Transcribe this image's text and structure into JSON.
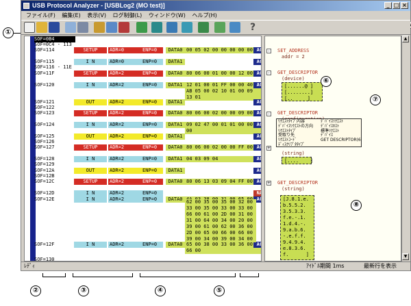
{
  "window": {
    "title": "USB Protocol Analyzer - [USBLog2 (MO test)]"
  },
  "menu": [
    "ファイル(F)",
    "編集(E)",
    "表示(V)",
    "ログ制御(L)",
    "ウィンドウ(W)",
    "ヘルプ(H)"
  ],
  "toolbar_icons": [
    "new-icon",
    "open-icon",
    "save-icon",
    "copy-icon",
    "cut-icon",
    "undo-icon",
    "paste-icon",
    "redo-icon",
    "edit-icon",
    "capture-icon",
    "filter-icon",
    "export-icon",
    "settings-icon",
    "tools-icon",
    "grid-icon",
    "help-icon"
  ],
  "trace": [
    {
      "sof": "SOF=0B4",
      "kind": "sof-dark"
    },
    {
      "sof": "SOF=0C4  - 113",
      "kind": "sof"
    },
    {
      "sof": "SOF=114",
      "token": "SETUP",
      "adr": "ADR=0",
      "enp": "ENP=0",
      "pid": "DATA0",
      "data": "00 05 02 00 00 00 00 00",
      "hs": "ACK"
    },
    {
      "sof": "SOF=115",
      "token": "I N",
      "adr": "ADR=0",
      "enp": "ENP=0",
      "pid": "DATA1",
      "data": "",
      "hs": "ACK"
    },
    {
      "sof": "SOF=116  - 11E",
      "kind": "sof"
    },
    {
      "sof": "SOF=11F",
      "token": "SETUP",
      "adr": "ADR=2",
      "enp": "ENP=0",
      "pid": "DATA0",
      "data": "80 06 00 01 00 00 12 00",
      "hs": "ACK"
    },
    {
      "sof": "SOF=120",
      "token": "I N",
      "adr": "ADR=2",
      "enp": "ENP=0",
      "pid": "DATA1",
      "data": "12 01 00 01 FF 00 00 40",
      "data2": "AB 05 00 02 10 01 00 09",
      "data3": "13 01",
      "hs": "ACK"
    },
    {
      "sof": "SOF=121",
      "token": "OUT",
      "adr": "ADR=2",
      "enp": "ENP=0",
      "pid": "DATA1",
      "data": "",
      "hs": "ACK"
    },
    {
      "sof": "SOF=122",
      "kind": "sof"
    },
    {
      "sof": "SOF=123",
      "token": "SETUP",
      "adr": "ADR=2",
      "enp": "ENP=0",
      "pid": "DATA0",
      "data": "80 06 00 02 00 00 09 00",
      "hs": "ACK"
    },
    {
      "sof": "SOF=124",
      "token": "I N",
      "adr": "ADR=2",
      "enp": "ENP=0",
      "pid": "DATA1",
      "data": "09 02 47 00 01 01 00 00",
      "data2": "00",
      "hs": "ACK"
    },
    {
      "sof": "SOF=125",
      "token": "OUT",
      "adr": "ADR=2",
      "enp": "ENP=0",
      "pid": "DATA1",
      "data": "",
      "hs": "ACK"
    },
    {
      "sof": "SOF=126",
      "kind": "sof"
    },
    {
      "sof": "SOF=127",
      "token": "SETUP",
      "adr": "ADR=2",
      "enp": "ENP=0",
      "pid": "DATA0",
      "data": "80 06 00 02 00 00 FF 00",
      "hs": "ACK"
    },
    {
      "sof": "SOF=128",
      "token": "I N",
      "adr": "ADR=2",
      "enp": "ENP=0",
      "pid": "DATA1",
      "data": "04 03 09 04",
      "hs": "ACK"
    },
    {
      "sof": "SOF=129",
      "kind": "sof"
    },
    {
      "sof": "SOF=12A",
      "token": "OUT",
      "adr": "ADR=2",
      "enp": "ENP=0",
      "pid": "DATA1",
      "data": "",
      "hs": "ACK"
    },
    {
      "sof": "SOF=12B",
      "kind": "sof"
    },
    {
      "sof": "SOF=12C",
      "token": "SETUP",
      "adr": "ADR=2",
      "enp": "ENP=0",
      "pid": "DATA0",
      "data": "80 06 13 03 09 04 FF 00",
      "hs": "ACK"
    },
    {
      "sof": "SOF=12D",
      "token": "I N",
      "adr": "ADR=2",
      "enp": "ENP=0",
      "pid": "",
      "data": "",
      "hs": "NAK"
    },
    {
      "sof": "SOF=12E",
      "token": "I N",
      "adr": "ADR=2",
      "enp": "ENP=0",
      "pid": "DATA0",
      "data": "4A 03 38 00 31 00 65 00",
      "hs": "ACK"
    },
    {
      "sof": "SOF=12F",
      "token": "I N",
      "adr": "ADR=2",
      "enp": "ENP=0",
      "pid": "DATA0",
      "data": "65 00 38 00 33 00 36 00",
      "data2": "66 00",
      "hs": "ACK"
    },
    {
      "sof": "SOF=130",
      "kind": "sof"
    },
    {
      "sof": "SOF=131",
      "token": "OUT",
      "adr": "ADR=2",
      "enp": "ENP=0",
      "pid": "DATA1",
      "data": "",
      "hs": "ACK"
    }
  ],
  "data_block_12E": [
    "62 00 35 00 35 00 32 00",
    "33 00 35 00 33 00 33 00",
    "66 00 61 00 2D 00 31 00",
    "31 00 64 00 34 00 20 00",
    "39 00 61 00 62 00 36 00",
    "2D 00 65 00 66 00 66 00",
    "39 00 34 00 39 00 34 00"
  ],
  "decoded": [
    {
      "title": "SET_ADDRESS",
      "sub": "addr = 2"
    },
    {
      "title": "GET_DESCRIPTOR",
      "sub": "(device)",
      "box": "[......@ ]\n[........]\n[..     ]"
    },
    {
      "title": "GET_DESCRIPTOR",
      "sub": "(configuration)"
    },
    {
      "title": "",
      "sub": "(string)",
      "box": "[....    ]"
    },
    {
      "title": "GET_DESCRIPTOR",
      "sub": "(string)",
      "box": "[J.8.1.e.\nb.5.5.2.\n3.5.3.3.\nf.e.-.1.\n1.d.4.-.\n9.a.b.6.\n-.e.f.f.\n9.4.9.4.\ne.8.3.6.\nf.      ]"
    }
  ],
  "tooltip_lines": [
    [
      "ﾘｸｴｽﾄﾀｲﾌﾟ内容",
      "ﾃﾞﾊﾞｲｽﾘｸｴｽﾄ"
    ],
    [
      "ﾃﾞﾊﾞｲｽﾘｸｴｽﾄの方向",
      "ﾃﾞﾊﾞｲｽﾎｽﾄ"
    ],
    [
      "ﾘｸｴｽﾄﾀｲﾌﾟ",
      "標準ﾘｸｴｽﾄ"
    ],
    [
      "受取り先",
      "ﾃﾞﾊﾞｲｽ"
    ],
    [
      "ﾘｸｴｽﾄｺｰﾄﾞ",
      "GET DESCRIPTOR(6)"
    ],
    [
      "ﾃﾞｨｽｸﾘﾌﾟﾀﾀｲﾌﾟ",
      ""
    ]
  ],
  "status": {
    "left": "ﾚﾃﾞｨ",
    "right1": "ｱｲﾄﾞﾙ期間 1ms",
    "right2": "最新行を表示"
  },
  "callouts": [
    "①",
    "②",
    "③",
    "④",
    "⑤",
    "⑥",
    "⑦",
    "⑧"
  ]
}
